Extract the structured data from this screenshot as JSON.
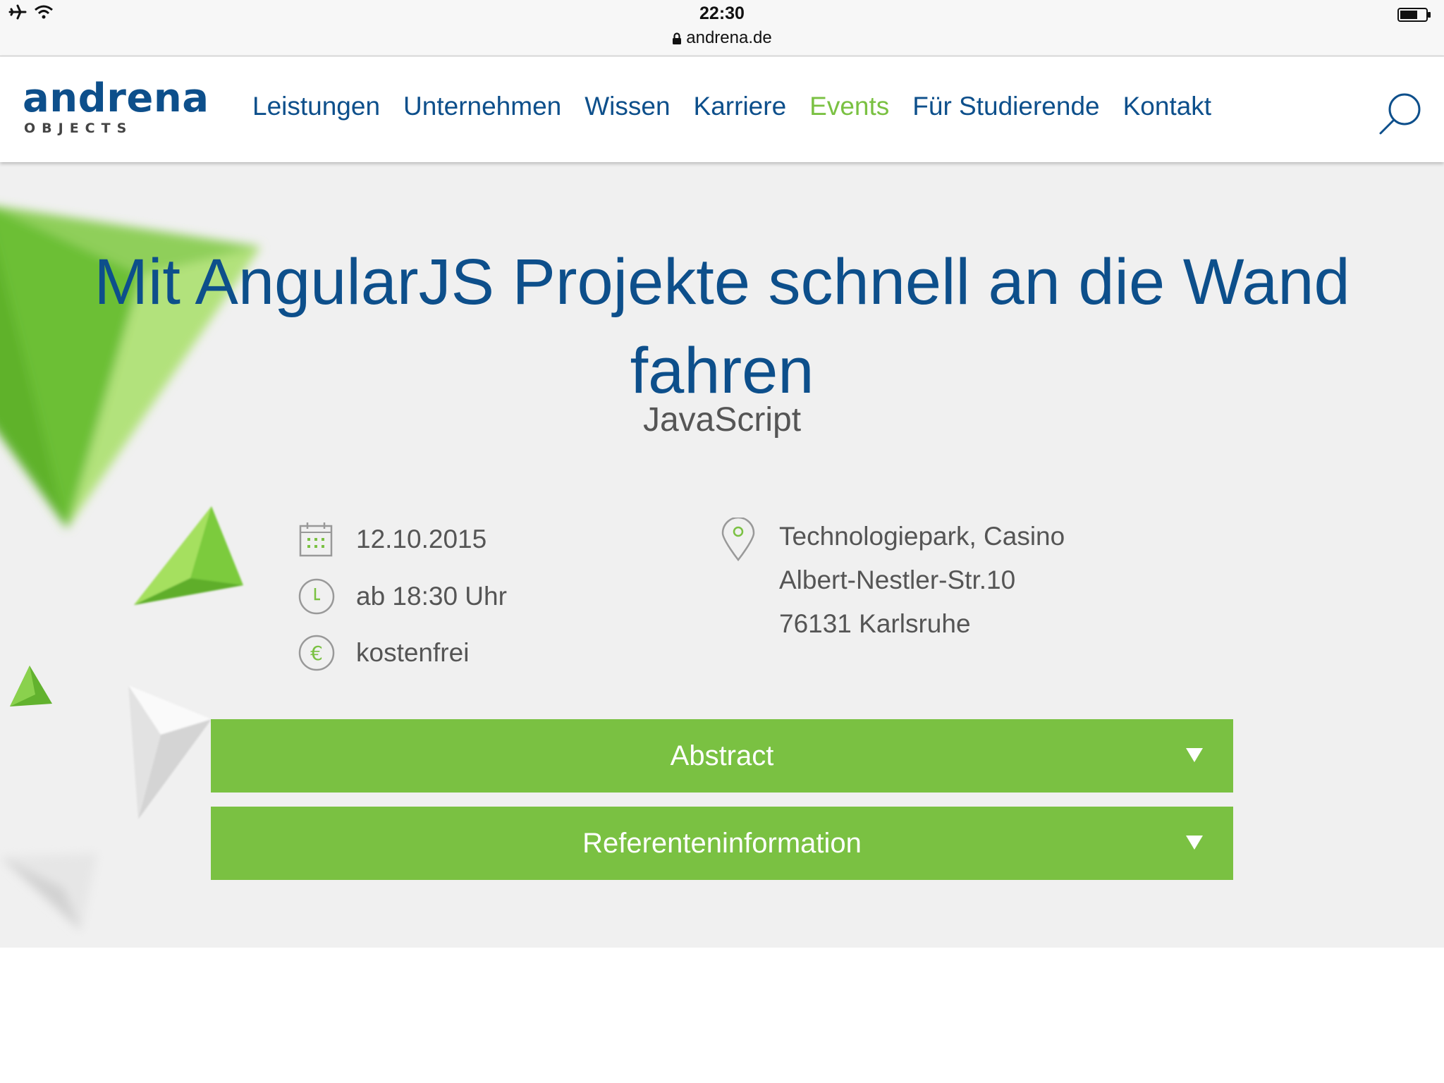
{
  "status_bar": {
    "time": "22:30",
    "url": "andrena.de",
    "icons": [
      "airplane-icon",
      "wifi-icon",
      "lock-icon",
      "battery-icon"
    ]
  },
  "header": {
    "logo": {
      "word": "andrena",
      "sub": "OBJECTS"
    },
    "nav": [
      {
        "label": "Leistungen",
        "active": false
      },
      {
        "label": "Unternehmen",
        "active": false
      },
      {
        "label": "Wissen",
        "active": false
      },
      {
        "label": "Karriere",
        "active": false
      },
      {
        "label": "Events",
        "active": true
      },
      {
        "label": "Für Studierende",
        "active": false
      },
      {
        "label": "Kontakt",
        "active": false
      }
    ],
    "search_icon": "search-icon"
  },
  "event": {
    "title": "Mit AngularJS Projekte schnell an die Wand fahren",
    "category": "JavaScript",
    "date": "12.10.2015",
    "time": "ab 18:30 Uhr",
    "price": "kostenfrei",
    "location": {
      "name": "Technologiepark, Casino",
      "street": "Albert-Nestler-Str.10",
      "city": "76131 Karlsruhe"
    }
  },
  "accordions": [
    {
      "label": "Abstract"
    },
    {
      "label": "Referenteninformation"
    }
  ],
  "colors": {
    "brand_blue": "#0d4f8b",
    "brand_green": "#7ac142",
    "hero_bg": "#f0f0f0",
    "text_gray": "#555555"
  }
}
